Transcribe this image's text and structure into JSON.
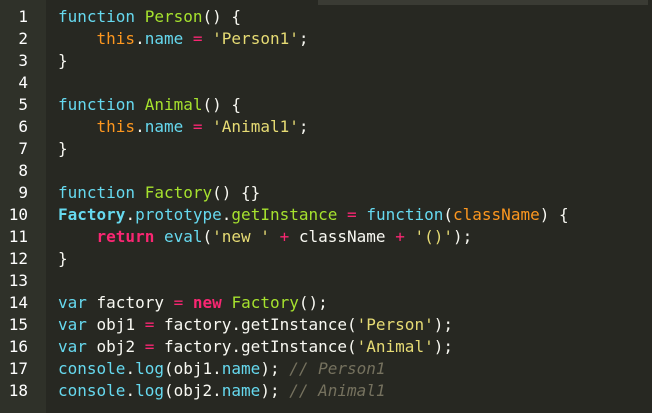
{
  "theme": {
    "background": "#272822",
    "gutter": "#2f3129",
    "keyword": "#66d9ef",
    "function_name": "#a6e22e",
    "this": "#fd971f",
    "operator": "#f92672",
    "string": "#e6db74",
    "text": "#f8f8f2",
    "comment": "#75715e"
  },
  "lines": [
    {
      "n": "1",
      "tokens": [
        {
          "c": "kw",
          "t": "function"
        },
        {
          "c": "plain",
          "t": " "
        },
        {
          "c": "fn",
          "t": "Person"
        },
        {
          "c": "punc",
          "t": "() {"
        }
      ]
    },
    {
      "n": "2",
      "tokens": [
        {
          "c": "plain",
          "t": "    "
        },
        {
          "c": "this",
          "t": "this"
        },
        {
          "c": "punc",
          "t": "."
        },
        {
          "c": "prop",
          "t": "name"
        },
        {
          "c": "plain",
          "t": " "
        },
        {
          "c": "op",
          "t": "="
        },
        {
          "c": "plain",
          "t": " "
        },
        {
          "c": "str",
          "t": "'Person1'"
        },
        {
          "c": "punc",
          "t": ";"
        }
      ]
    },
    {
      "n": "3",
      "tokens": [
        {
          "c": "punc",
          "t": "}"
        }
      ]
    },
    {
      "n": "4",
      "tokens": []
    },
    {
      "n": "5",
      "tokens": [
        {
          "c": "kw",
          "t": "function"
        },
        {
          "c": "plain",
          "t": " "
        },
        {
          "c": "fn",
          "t": "Animal"
        },
        {
          "c": "punc",
          "t": "() {"
        }
      ]
    },
    {
      "n": "6",
      "tokens": [
        {
          "c": "plain",
          "t": "    "
        },
        {
          "c": "this",
          "t": "this"
        },
        {
          "c": "punc",
          "t": "."
        },
        {
          "c": "prop",
          "t": "name"
        },
        {
          "c": "plain",
          "t": " "
        },
        {
          "c": "op",
          "t": "="
        },
        {
          "c": "plain",
          "t": " "
        },
        {
          "c": "str",
          "t": "'Animal1'"
        },
        {
          "c": "punc",
          "t": ";"
        }
      ]
    },
    {
      "n": "7",
      "tokens": [
        {
          "c": "punc",
          "t": "}"
        }
      ]
    },
    {
      "n": "8",
      "tokens": []
    },
    {
      "n": "9",
      "tokens": [
        {
          "c": "kw",
          "t": "function"
        },
        {
          "c": "plain",
          "t": " "
        },
        {
          "c": "fn",
          "t": "Factory"
        },
        {
          "c": "punc",
          "t": "() {}"
        }
      ]
    },
    {
      "n": "10",
      "tokens": [
        {
          "c": "cls",
          "t": "Factory"
        },
        {
          "c": "punc",
          "t": "."
        },
        {
          "c": "prop",
          "t": "prototype"
        },
        {
          "c": "punc",
          "t": "."
        },
        {
          "c": "fn",
          "t": "getInstance"
        },
        {
          "c": "plain",
          "t": " "
        },
        {
          "c": "op",
          "t": "="
        },
        {
          "c": "plain",
          "t": " "
        },
        {
          "c": "kw",
          "t": "function"
        },
        {
          "c": "punc",
          "t": "("
        },
        {
          "c": "param",
          "t": "className"
        },
        {
          "c": "punc",
          "t": ") {"
        }
      ]
    },
    {
      "n": "11",
      "tokens": [
        {
          "c": "plain",
          "t": "    "
        },
        {
          "c": "ret",
          "t": "return"
        },
        {
          "c": "plain",
          "t": " "
        },
        {
          "c": "builtin",
          "t": "eval"
        },
        {
          "c": "punc",
          "t": "("
        },
        {
          "c": "str",
          "t": "'new '"
        },
        {
          "c": "plain",
          "t": " "
        },
        {
          "c": "op",
          "t": "+"
        },
        {
          "c": "plain",
          "t": " className "
        },
        {
          "c": "op",
          "t": "+"
        },
        {
          "c": "plain",
          "t": " "
        },
        {
          "c": "str",
          "t": "'()'"
        },
        {
          "c": "punc",
          "t": ");"
        }
      ]
    },
    {
      "n": "12",
      "tokens": [
        {
          "c": "punc",
          "t": "}"
        }
      ]
    },
    {
      "n": "13",
      "tokens": []
    },
    {
      "n": "14",
      "tokens": [
        {
          "c": "kw",
          "t": "var"
        },
        {
          "c": "plain",
          "t": " factory "
        },
        {
          "c": "op",
          "t": "="
        },
        {
          "c": "plain",
          "t": " "
        },
        {
          "c": "new",
          "t": "new"
        },
        {
          "c": "plain",
          "t": " "
        },
        {
          "c": "fn",
          "t": "Factory"
        },
        {
          "c": "punc",
          "t": "();"
        }
      ]
    },
    {
      "n": "15",
      "tokens": [
        {
          "c": "kw",
          "t": "var"
        },
        {
          "c": "plain",
          "t": " obj1 "
        },
        {
          "c": "op",
          "t": "="
        },
        {
          "c": "plain",
          "t": " factory.getInstance("
        },
        {
          "c": "str",
          "t": "'Person'"
        },
        {
          "c": "punc",
          "t": ");"
        }
      ]
    },
    {
      "n": "16",
      "tokens": [
        {
          "c": "kw",
          "t": "var"
        },
        {
          "c": "plain",
          "t": " obj2 "
        },
        {
          "c": "op",
          "t": "="
        },
        {
          "c": "plain",
          "t": " factory.getInstance("
        },
        {
          "c": "str",
          "t": "'Animal'"
        },
        {
          "c": "punc",
          "t": ");"
        }
      ]
    },
    {
      "n": "17",
      "tokens": [
        {
          "c": "builtin",
          "t": "console"
        },
        {
          "c": "punc",
          "t": "."
        },
        {
          "c": "builtin",
          "t": "log"
        },
        {
          "c": "punc",
          "t": "(obj1."
        },
        {
          "c": "prop",
          "t": "name"
        },
        {
          "c": "punc",
          "t": "); "
        },
        {
          "c": "comment",
          "t": "// Person1"
        }
      ]
    },
    {
      "n": "18",
      "tokens": [
        {
          "c": "builtin",
          "t": "console"
        },
        {
          "c": "punc",
          "t": "."
        },
        {
          "c": "builtin",
          "t": "log"
        },
        {
          "c": "punc",
          "t": "(obj2."
        },
        {
          "c": "prop",
          "t": "name"
        },
        {
          "c": "punc",
          "t": "); "
        },
        {
          "c": "comment",
          "t": "// Animal1"
        }
      ]
    }
  ]
}
